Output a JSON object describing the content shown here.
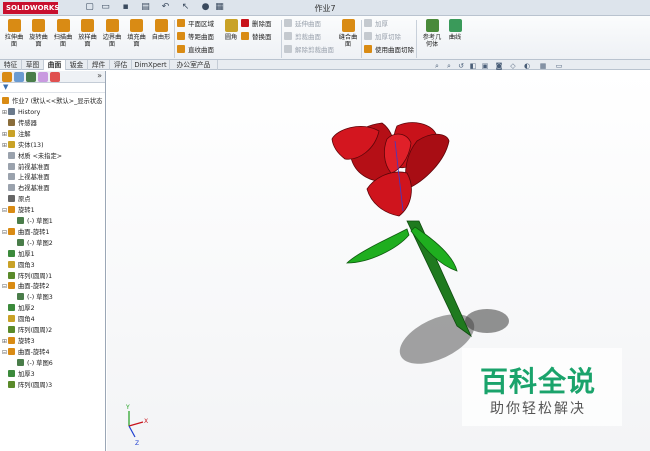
{
  "app": {
    "brand": "SOLIDWORKS",
    "doc_title": "作业7"
  },
  "ribbon": {
    "buttons": [
      {
        "label": "拉伸曲面",
        "color": "#d98b14"
      },
      {
        "label": "旋转曲面",
        "color": "#d98b14"
      },
      {
        "label": "扫描曲面",
        "color": "#d98b14"
      },
      {
        "label": "放样曲面",
        "color": "#d98b14"
      },
      {
        "label": "边界曲面",
        "color": "#d98b14"
      },
      {
        "label": "填充曲面",
        "color": "#d98b14"
      },
      {
        "label": "自由形",
        "color": "#d98b14"
      }
    ],
    "col1": [
      "平面区域",
      "等距曲面",
      "直纹曲面"
    ],
    "fillet_label": "圆角",
    "col2": [
      "删除面",
      "替换面"
    ],
    "col3_disabled": [
      "延伸曲面",
      "剪裁曲面",
      "解除剪裁曲面"
    ],
    "knit_label": "缝合曲面",
    "col4_disabled": [
      "加厚",
      "加厚切除"
    ],
    "col4_enabled": "使用曲面切除",
    "ref_geom_label": "参考几何体",
    "curves_label": "曲线"
  },
  "tabs": [
    "特征",
    "草图",
    "曲面",
    "钣金",
    "焊件",
    "评估",
    "DimXpert",
    "办公室产品"
  ],
  "active_tab": "曲面",
  "tree": {
    "root": "作业7 (默认<<默认>_显示状态",
    "items": [
      {
        "label": "History",
        "depth": 0,
        "exp": "+",
        "color": "#6b7a8c"
      },
      {
        "label": "传感器",
        "depth": 0,
        "exp": "",
        "color": "#8a6d3b"
      },
      {
        "label": "注解",
        "depth": 0,
        "exp": "+",
        "color": "#c9a227"
      },
      {
        "label": "实体(13)",
        "depth": 0,
        "exp": "+",
        "color": "#c9a227"
      },
      {
        "label": "材质 <未指定>",
        "depth": 0,
        "exp": "",
        "color": "#9aa2ad"
      },
      {
        "label": "前视基准面",
        "depth": 0,
        "exp": "",
        "color": "#9aa2ad"
      },
      {
        "label": "上视基准面",
        "depth": 0,
        "exp": "",
        "color": "#9aa2ad"
      },
      {
        "label": "右视基准面",
        "depth": 0,
        "exp": "",
        "color": "#9aa2ad"
      },
      {
        "label": "原点",
        "depth": 0,
        "exp": "",
        "color": "#666"
      },
      {
        "label": "旋转1",
        "depth": 0,
        "exp": "-",
        "color": "#d98b14"
      },
      {
        "label": "(-) 草图1",
        "depth": 1,
        "exp": "",
        "color": "#4a7d4a"
      },
      {
        "label": "曲面-旋转1",
        "depth": 0,
        "exp": "-",
        "color": "#d98b14"
      },
      {
        "label": "(-) 草图2",
        "depth": 1,
        "exp": "",
        "color": "#4a7d4a"
      },
      {
        "label": "加厚1",
        "depth": 0,
        "exp": "",
        "color": "#3b8a3b"
      },
      {
        "label": "圆角3",
        "depth": 0,
        "exp": "",
        "color": "#c9a227"
      },
      {
        "label": "阵列(圆周)1",
        "depth": 0,
        "exp": "",
        "color": "#5a8a2a"
      },
      {
        "label": "曲面-旋转2",
        "depth": 0,
        "exp": "-",
        "color": "#d98b14"
      },
      {
        "label": "(-) 草图3",
        "depth": 1,
        "exp": "",
        "color": "#4a7d4a"
      },
      {
        "label": "加厚2",
        "depth": 0,
        "exp": "",
        "color": "#3b8a3b"
      },
      {
        "label": "圆角4",
        "depth": 0,
        "exp": "",
        "color": "#c9a227"
      },
      {
        "label": "阵列(圆周)2",
        "depth": 0,
        "exp": "",
        "color": "#5a8a2a"
      },
      {
        "label": "旋转3",
        "depth": 0,
        "exp": "+",
        "color": "#d98b14"
      },
      {
        "label": "曲面-旋转4",
        "depth": 0,
        "exp": "-",
        "color": "#d98b14"
      },
      {
        "label": "(-) 草图6",
        "depth": 1,
        "exp": "",
        "color": "#4a7d4a"
      },
      {
        "label": "加厚3",
        "depth": 0,
        "exp": "",
        "color": "#3b8a3b"
      },
      {
        "label": "阵列(圆周)3",
        "depth": 0,
        "exp": "",
        "color": "#5a8a2a"
      }
    ]
  },
  "model": {
    "petal_color": "#c8121a",
    "stem_color": "#1f7a1f",
    "leaf_color": "#1fae1f"
  },
  "watermark": {
    "main": "百科全说",
    "sub": "助你轻松解决"
  },
  "triad": {
    "x": "X",
    "y": "Y",
    "z": "Z"
  }
}
